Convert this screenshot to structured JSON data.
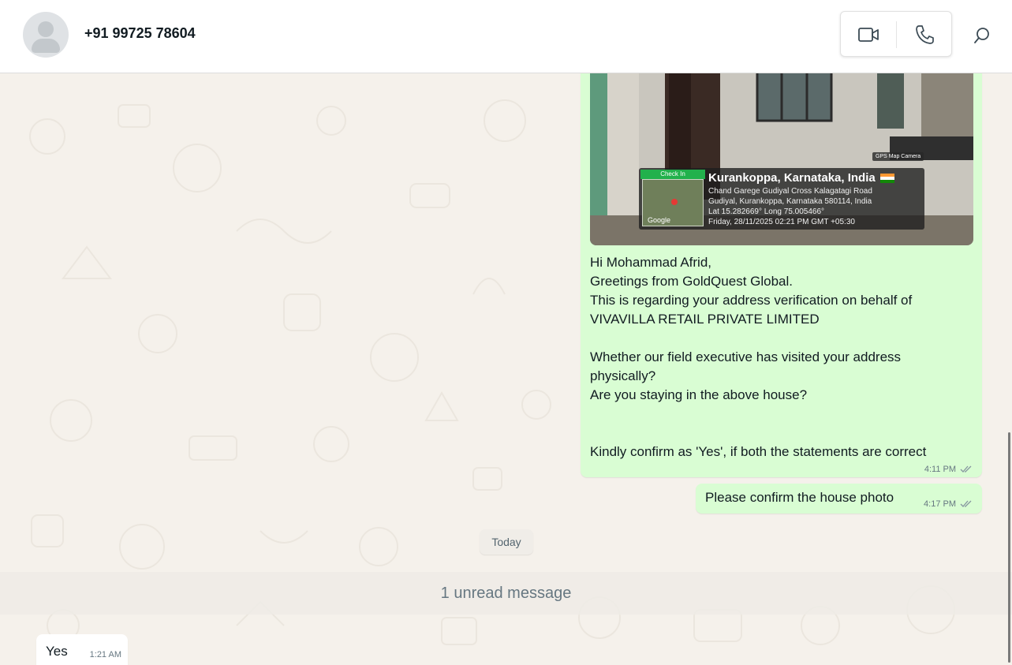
{
  "header": {
    "contact_name": "+91 99725 78604"
  },
  "messages": [
    {
      "direction": "outgoing",
      "photo": {
        "gps_stamp": {
          "checkin_label": "Check In",
          "brand": "GPS Map Camera",
          "location_title": "Kurankoppa, Karnataka, India",
          "address_line1": "Chand Garege Gudiyal Cross Kalagatagi Road",
          "address_line2": "Gudiyal, Kurankoppa, Karnataka 580114, India",
          "coords": "Lat 15.282669° Long 75.005466°",
          "datetime": "Friday, 28/11/2025 02:21 PM GMT +05:30",
          "map_label": "Google"
        }
      },
      "text": "Hi Mohammad Afrid,\nGreetings from GoldQuest Global.\nThis is regarding your address verification on behalf of\nVIVAVILLA RETAIL PRIVATE LIMITED\n\nWhether our field executive has visited your address\nphysically?\nAre you staying in the above house?\n\n\nKindly confirm as 'Yes', if both the statements are correct",
      "time": "4:11 PM"
    },
    {
      "direction": "outgoing",
      "text": "Please confirm the house photo",
      "time": "4:17 PM"
    },
    {
      "direction": "incoming",
      "text": "Yes",
      "time": "1:21 AM"
    }
  ],
  "date_divider": "Today",
  "unread_banner": "1 unread message",
  "colors": {
    "outgoing_bubble": "#d9fdd3",
    "incoming_bubble": "#ffffff",
    "wallpaper": "#f5f1eb"
  },
  "icons": [
    "video-call-icon",
    "voice-call-icon",
    "search-icon",
    "double-check-icon"
  ]
}
